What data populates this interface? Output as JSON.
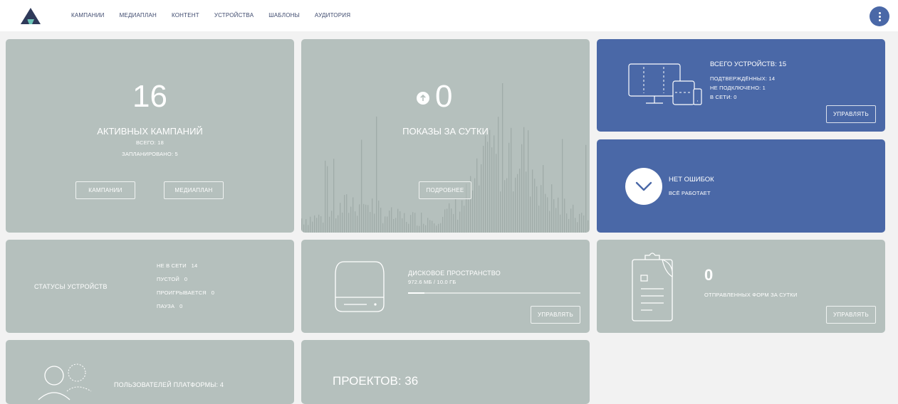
{
  "nav": {
    "items": [
      "КАМПАНИИ",
      "МЕДИАПЛАН",
      "КОНТЕНТ",
      "УСТРОЙСТВА",
      "ШАБЛОНЫ",
      "АУДИТОРИЯ"
    ]
  },
  "campaigns": {
    "count": "16",
    "title": "АКТИВНЫХ КАМПАНИЙ",
    "total": "ВСЕГО: 18",
    "scheduled": "ЗАПЛАНИРОВАНО: 5",
    "btn_campaigns": "КАМПАНИИ",
    "btn_mediaplan": "МЕДИАПЛАН"
  },
  "impressions": {
    "count": "0",
    "title": "ПОКАЗЫ ЗА СУТКИ",
    "btn_more": "ПОДРОБНЕЕ"
  },
  "devices": {
    "total": "ВСЕГО УСТРОЙСТВ: 15",
    "confirmed": "ПОДТВЕРЖДЁННЫХ: 14",
    "not_connected": "НЕ ПОДКЛЮЧЕНО: 1",
    "online": "В СЕТИ: 0",
    "btn_manage": "УПРАВЛЯТЬ"
  },
  "errors": {
    "title": "НЕТ ОШИБОК",
    "subtitle": "ВСЁ РАБОТАЕТ"
  },
  "statuses": {
    "title": "СТАТУСЫ УСТРОЙСТВ",
    "rows": [
      {
        "label": "НЕ В СЕТИ",
        "value": "14"
      },
      {
        "label": "ПУСТОЙ",
        "value": "0"
      },
      {
        "label": "ПРОИГРЫВАЕТСЯ",
        "value": "0"
      },
      {
        "label": "ПАУЗА",
        "value": "0"
      }
    ]
  },
  "disk": {
    "title": "ДИСКОВОЕ ПРОСТРАНСТВО",
    "usage": "972.6 МБ / 10.0 ГБ",
    "used_fraction": 0.097,
    "btn_manage": "УПРАВЛЯТЬ"
  },
  "forms": {
    "count": "0",
    "title": "ОТПРАВЛЕННЫХ ФОРМ ЗА СУТКИ",
    "btn_manage": "УПРАВЛЯТЬ"
  },
  "users": {
    "title": "ПОЛЬЗОВАТЕЛЕЙ ПЛАТФОРМЫ: 4"
  },
  "projects": {
    "title": "ПРОЕКТОВ: 36"
  },
  "colors": {
    "accent": "#4a68a7",
    "card_gray": "#b5c0bd",
    "background": "#f2f2f2"
  }
}
